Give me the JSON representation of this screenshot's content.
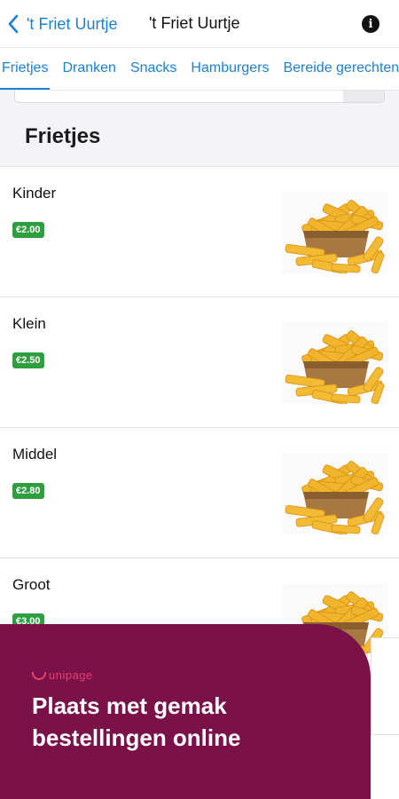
{
  "navbar": {
    "back_label": "'t Friet Uurtje",
    "title": "'t Friet Uurtje",
    "info_icon": "i"
  },
  "tabs": [
    {
      "label": "Frietjes",
      "active": true
    },
    {
      "label": "Dranken",
      "active": false
    },
    {
      "label": "Snacks",
      "active": false
    },
    {
      "label": "Hamburgers",
      "active": false
    },
    {
      "label": "Bereide gerechten",
      "active": false
    }
  ],
  "section": {
    "title": "Frietjes"
  },
  "items": [
    {
      "name": "Kinder",
      "price": "€2.00",
      "image": "fries-image"
    },
    {
      "name": "Klein",
      "price": "€2.50",
      "image": "fries-image"
    },
    {
      "name": "Middel",
      "price": "€2.80",
      "image": "fries-image"
    },
    {
      "name": "Groot",
      "price": "€3.00",
      "image": "fries-image"
    }
  ],
  "promo": {
    "brand": "unipage",
    "text": "Plaats met gemak bestellingen online"
  },
  "colors": {
    "accent": "#1a7fd9",
    "price_badge": "#2e9e3e",
    "promo_bg": "#7a1149",
    "section_bg": "#f3f3f8"
  }
}
